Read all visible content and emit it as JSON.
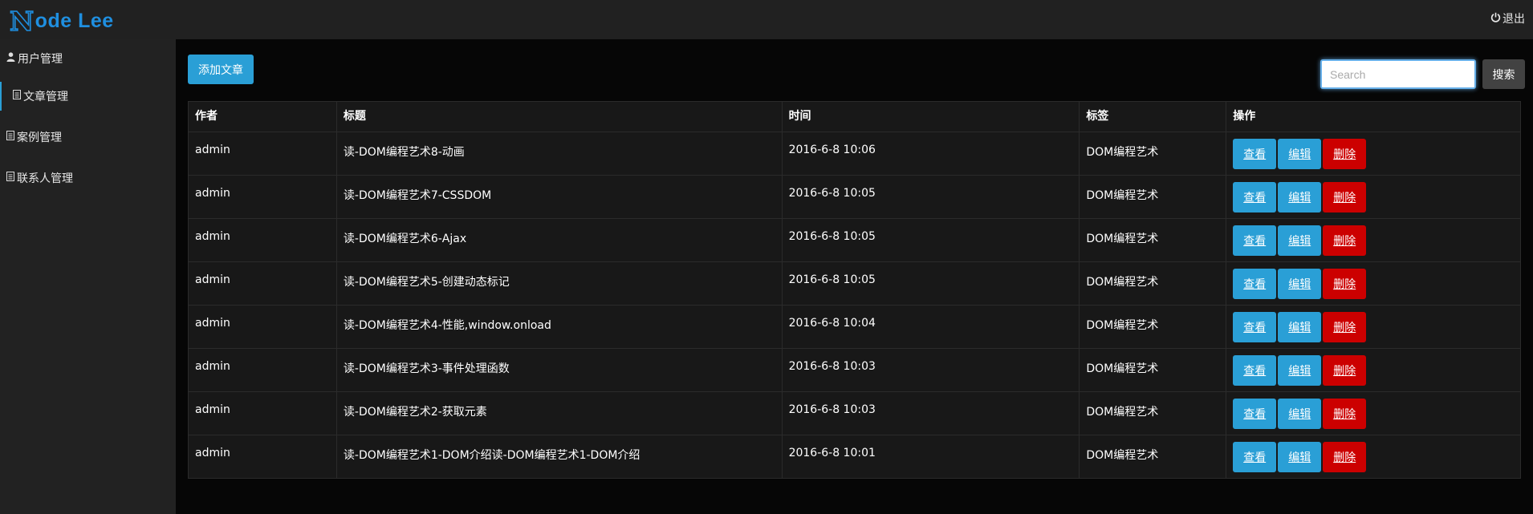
{
  "brand": {
    "letter": "N",
    "rest": "ode Lee",
    "color": "#1f8fe0"
  },
  "header": {
    "logout_icon": "power-icon",
    "logout_label": "退出"
  },
  "sidebar": {
    "items": [
      {
        "label": "用户管理",
        "icon": "user-icon"
      },
      {
        "label": "文章管理",
        "icon": "document-icon",
        "active": true
      },
      {
        "label": "案例管理",
        "icon": "document-icon"
      },
      {
        "label": "联系人管理",
        "icon": "document-icon"
      }
    ]
  },
  "toolbar": {
    "add_label": "添加文章",
    "search_placeholder": "Search",
    "search_label": "搜索"
  },
  "table": {
    "headers": [
      "作者",
      "标题",
      "时间",
      "标签",
      "操作"
    ],
    "action_labels": {
      "view": "查看",
      "edit": "编辑",
      "delete": "删除"
    },
    "rows": [
      {
        "author": "admin",
        "title": "读-DOM编程艺术8-动画",
        "time": "2016-6-8 10:06",
        "tag": "DOM编程艺术"
      },
      {
        "author": "admin",
        "title": "读-DOM编程艺术7-CSSDOM",
        "time": "2016-6-8 10:05",
        "tag": "DOM编程艺术"
      },
      {
        "author": "admin",
        "title": "读-DOM编程艺术6-Ajax",
        "time": "2016-6-8 10:05",
        "tag": "DOM编程艺术"
      },
      {
        "author": "admin",
        "title": "读-DOM编程艺术5-创建动态标记",
        "time": "2016-6-8 10:05",
        "tag": "DOM编程艺术"
      },
      {
        "author": "admin",
        "title": "读-DOM编程艺术4-性能,window.onload",
        "time": "2016-6-8 10:04",
        "tag": "DOM编程艺术"
      },
      {
        "author": "admin",
        "title": "读-DOM编程艺术3-事件处理函数",
        "time": "2016-6-8 10:03",
        "tag": "DOM编程艺术"
      },
      {
        "author": "admin",
        "title": "读-DOM编程艺术2-获取元素",
        "time": "2016-6-8 10:03",
        "tag": "DOM编程艺术"
      },
      {
        "author": "admin",
        "title": "读-DOM编程艺术1-DOM介绍读-DOM编程艺术1-DOM介绍",
        "time": "2016-6-8 10:01",
        "tag": "DOM编程艺术"
      }
    ]
  },
  "colors": {
    "primary": "#2a9fd6",
    "danger": "#cc0000",
    "background": "#060606",
    "sidebar": "#222222"
  }
}
